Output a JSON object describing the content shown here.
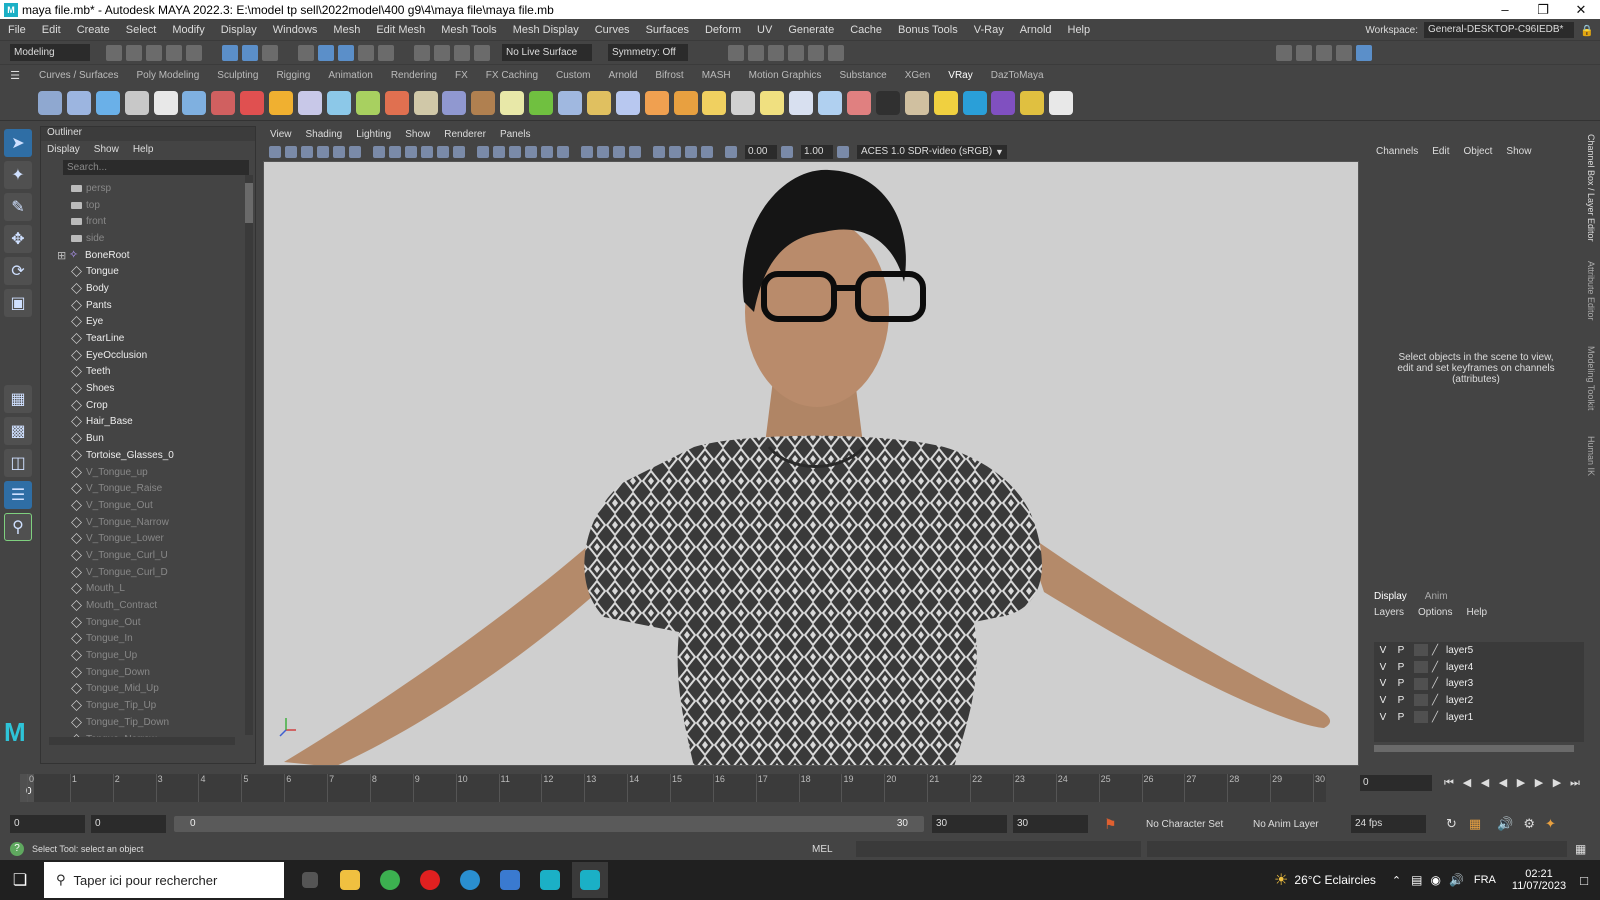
{
  "window": {
    "title": "maya file.mb* - Autodesk MAYA 2022.3: E:\\model tp sell\\2022model\\400 g9\\4\\maya file\\maya file.mb"
  },
  "menubar": {
    "items": [
      "File",
      "Edit",
      "Create",
      "Select",
      "Modify",
      "Display",
      "Windows",
      "Mesh",
      "Edit Mesh",
      "Mesh Tools",
      "Mesh Display",
      "Curves",
      "Surfaces",
      "Deform",
      "UV",
      "Generate",
      "Cache",
      "Bonus Tools",
      "V-Ray",
      "Arnold",
      "Help"
    ],
    "workspace_label": "Workspace:",
    "workspace_value": "General-DESKTOP-C96IEDB*"
  },
  "statusline": {
    "mode": "Modeling",
    "live_surface": "No Live Surface",
    "symmetry": "Symmetry: Off"
  },
  "shelf": {
    "tabs": [
      "Curves / Surfaces",
      "Poly Modeling",
      "Sculpting",
      "Rigging",
      "Animation",
      "Rendering",
      "FX",
      "FX Caching",
      "Custom",
      "Arnold",
      "Bifrost",
      "MASH",
      "Motion Graphics",
      "Substance",
      "XGen",
      "VRay",
      "DazToMaya"
    ],
    "active_tab": "VRay",
    "icon_colors": [
      "#8fa8d0",
      "#9cb5e0",
      "#6ab0e8",
      "#c8c8c8",
      "#e8e8e8",
      "#7fb0e0",
      "#d06060",
      "#e05050",
      "#f0b030",
      "#c8c8e8",
      "#8cc8e8",
      "#a8d060",
      "#e07050",
      "#d0c8a8",
      "#9098d0",
      "#b08050",
      "#e8e8a8",
      "#70c040",
      "#a0b8e0",
      "#e0c060",
      "#b8c8f0",
      "#f0a050",
      "#e8a040",
      "#f0d060",
      "#d0d0d0",
      "#f0e080",
      "#d8e0f0",
      "#b0d0f0",
      "#e08080",
      "#303030",
      "#d0c0a0",
      "#f0d040",
      "#2a9fd8",
      "#8050c0",
      "#e0c040",
      "#e8e8e8"
    ]
  },
  "outliner": {
    "title": "Outliner",
    "menu": [
      "Display",
      "Show",
      "Help"
    ],
    "search_placeholder": "Search...",
    "items": [
      {
        "name": "persp",
        "type": "cam",
        "dim": true
      },
      {
        "name": "top",
        "type": "cam",
        "dim": true
      },
      {
        "name": "front",
        "type": "cam",
        "dim": true
      },
      {
        "name": "side",
        "type": "cam",
        "dim": true
      },
      {
        "name": "BoneRoot",
        "type": "bone",
        "dim": false
      },
      {
        "name": "Tongue",
        "type": "mesh",
        "dim": false
      },
      {
        "name": "Body",
        "type": "mesh",
        "dim": false
      },
      {
        "name": "Pants",
        "type": "mesh",
        "dim": false
      },
      {
        "name": "Eye",
        "type": "mesh",
        "dim": false
      },
      {
        "name": "TearLine",
        "type": "mesh",
        "dim": false
      },
      {
        "name": "EyeOcclusion",
        "type": "mesh",
        "dim": false
      },
      {
        "name": "Teeth",
        "type": "mesh",
        "dim": false
      },
      {
        "name": "Shoes",
        "type": "mesh",
        "dim": false
      },
      {
        "name": "Crop",
        "type": "mesh",
        "dim": false
      },
      {
        "name": "Hair_Base",
        "type": "mesh",
        "dim": false
      },
      {
        "name": "Bun",
        "type": "mesh",
        "dim": false
      },
      {
        "name": "Tortoise_Glasses_0",
        "type": "mesh",
        "dim": false
      },
      {
        "name": "V_Tongue_up",
        "type": "mesh",
        "dim": true
      },
      {
        "name": "V_Tongue_Raise",
        "type": "mesh",
        "dim": true
      },
      {
        "name": "V_Tongue_Out",
        "type": "mesh",
        "dim": true
      },
      {
        "name": "V_Tongue_Narrow",
        "type": "mesh",
        "dim": true
      },
      {
        "name": "V_Tongue_Lower",
        "type": "mesh",
        "dim": true
      },
      {
        "name": "V_Tongue_Curl_U",
        "type": "mesh",
        "dim": true
      },
      {
        "name": "V_Tongue_Curl_D",
        "type": "mesh",
        "dim": true
      },
      {
        "name": "Mouth_L",
        "type": "mesh",
        "dim": true
      },
      {
        "name": "Mouth_Contract",
        "type": "mesh",
        "dim": true
      },
      {
        "name": "Tongue_Out",
        "type": "mesh",
        "dim": true
      },
      {
        "name": "Tongue_In",
        "type": "mesh",
        "dim": true
      },
      {
        "name": "Tongue_Up",
        "type": "mesh",
        "dim": true
      },
      {
        "name": "Tongue_Down",
        "type": "mesh",
        "dim": true
      },
      {
        "name": "Tongue_Mid_Up",
        "type": "mesh",
        "dim": true
      },
      {
        "name": "Tongue_Tip_Up",
        "type": "mesh",
        "dim": true
      },
      {
        "name": "Tongue_Tip_Down",
        "type": "mesh",
        "dim": true
      },
      {
        "name": "Tongue_Narrow",
        "type": "mesh",
        "dim": true
      }
    ]
  },
  "viewport": {
    "menu": [
      "View",
      "Shading",
      "Lighting",
      "Show",
      "Renderer",
      "Panels"
    ],
    "exposure": "0.00",
    "gamma": "1.00",
    "color_space": "ACES 1.0 SDR-video (sRGB)",
    "background": "#cfcfcf"
  },
  "channelbox": {
    "menu": [
      "Channels",
      "Edit",
      "Object",
      "Show"
    ],
    "message": "Select objects in the scene to view, edit and set keyframes on channels (attributes)",
    "side_tabs": [
      "Channel Box / Layer Editor",
      "Attribute Editor",
      "Modeling Toolkit",
      "Human IK"
    ]
  },
  "layer_editor": {
    "tabs": [
      "Display",
      "Anim"
    ],
    "active_tab": "Display",
    "menu": [
      "Layers",
      "Options",
      "Help"
    ],
    "layers": [
      {
        "v": "V",
        "p": "P",
        "name": "layer5"
      },
      {
        "v": "V",
        "p": "P",
        "name": "layer4"
      },
      {
        "v": "V",
        "p": "P",
        "name": "layer3"
      },
      {
        "v": "V",
        "p": "P",
        "name": "layer2"
      },
      {
        "v": "V",
        "p": "P",
        "name": "layer1"
      }
    ]
  },
  "timeline": {
    "ticks": [
      "0",
      "1",
      "2",
      "3",
      "4",
      "5",
      "6",
      "7",
      "8",
      "9",
      "10",
      "11",
      "12",
      "13",
      "14",
      "15",
      "16",
      "17",
      "18",
      "19",
      "20",
      "21",
      "22",
      "23",
      "24",
      "25",
      "26",
      "27",
      "28",
      "29",
      "30"
    ],
    "current_marker": "0",
    "current_frame": "0"
  },
  "range": {
    "start": "0",
    "playback_start": "0",
    "range_start_label": "0",
    "range_end_label": "30",
    "playback_end": "30",
    "end": "30",
    "character_set": "No Character Set",
    "anim_layer": "No Anim Layer",
    "fps": "24 fps"
  },
  "helpline": {
    "text": "Select Tool: select an object",
    "mel_label": "MEL"
  },
  "taskbar": {
    "search_placeholder": "Taper ici pour rechercher",
    "weather": "26°C  Eclaircies",
    "language": "FRA",
    "time": "02:21",
    "date": "11/07/2023"
  }
}
